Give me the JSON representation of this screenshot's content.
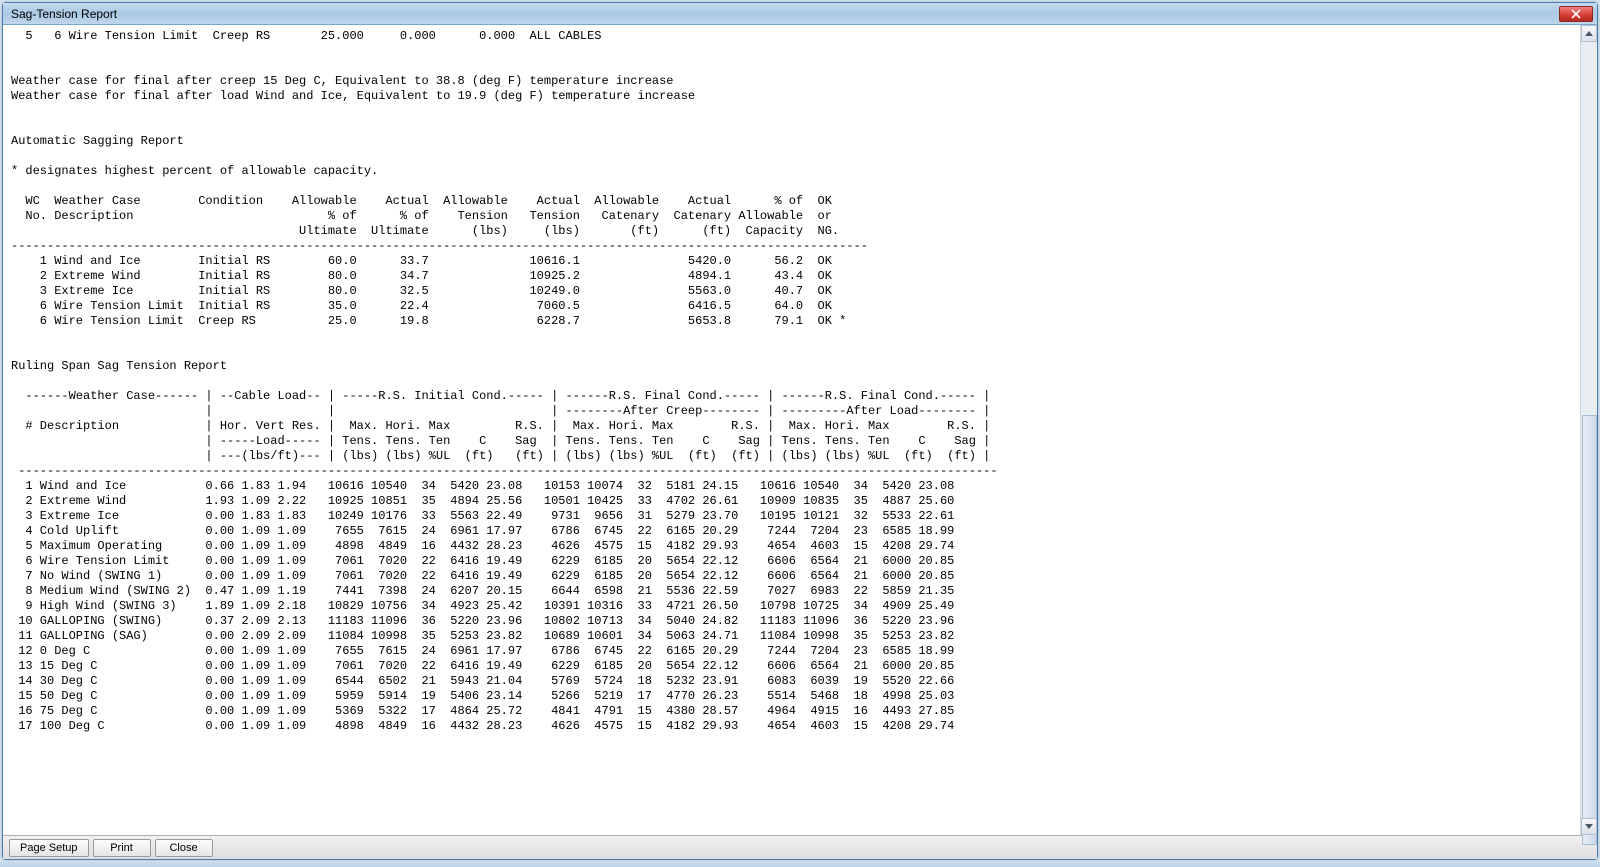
{
  "window": {
    "title": "Sag-Tension Report"
  },
  "toolbar": {
    "page_setup": "Page Setup",
    "print": "Print",
    "close": "Close"
  },
  "report": {
    "top_line": "  5   6 Wire Tension Limit  Creep RS       25.000     0.000      0.000  ALL CABLES",
    "wc_note_creep": "Weather case for final after creep 15 Deg C, Equivalent to 38.8 (deg F) temperature increase",
    "wc_note_load": "Weather case for final after load Wind and Ice, Equivalent to 19.9 (deg F) temperature increase",
    "auto_sagging_title": "Automatic Sagging Report",
    "star_note": "* designates highest percent of allowable capacity.",
    "sag_header": [
      "  WC  Weather Case        Condition    Allowable    Actual  Allowable    Actual  Allowable    Actual      % of  OK",
      "  No. Description                           % of      % of    Tension   Tension   Catenary  Catenary Allowable  or",
      "                                        Ultimate  Ultimate      (lbs)     (lbs)       (ft)      (ft)  Capacity  NG.",
      "-----------------------------------------------------------------------------------------------------------------------"
    ],
    "sag_rows": [
      "    1 Wind and Ice        Initial RS        60.0      33.7              10616.1               5420.0      56.2  OK",
      "    2 Extreme Wind        Initial RS        80.0      34.7              10925.2               4894.1      43.4  OK",
      "    3 Extreme Ice         Initial RS        80.0      32.5              10249.0               5563.0      40.7  OK",
      "    6 Wire Tension Limit  Initial RS        35.0      22.4               7060.5               6416.5      64.0  OK",
      "    6 Wire Tension Limit  Creep RS          25.0      19.8               6228.7               5653.8      79.1  OK *"
    ],
    "ruling_title": "Ruling Span Sag Tension Report",
    "ruling_header": [
      "  ------Weather Case------ | --Cable Load-- | -----R.S. Initial Cond.----- | ------R.S. Final Cond.----- | ------R.S. Final Cond.----- |",
      "                           |                |                              | --------After Creep-------- | ---------After Load-------- |",
      "  # Description            | Hor. Vert Res. |  Max. Hori. Max         R.S. |  Max. Hori. Max        R.S. |  Max. Hori. Max        R.S. |",
      "                           | -----Load----- | Tens. Tens. Ten    C    Sag  | Tens. Tens. Ten    C    Sag | Tens. Tens. Ten    C    Sag |",
      "                           | ---(lbs/ft)--- | (lbs) (lbs) %UL  (ft)   (ft) | (lbs) (lbs) %UL  (ft)  (ft) | (lbs) (lbs) %UL  (ft)  (ft) |",
      " ----------------------------------------------------------------------------------------------------------------------------------------"
    ],
    "ruling_rows": [
      "  1 Wind and Ice           0.66 1.83 1.94   10616 10540  34  5420 23.08   10153 10074  32  5181 24.15   10616 10540  34  5420 23.08",
      "  2 Extreme Wind           1.93 1.09 2.22   10925 10851  35  4894 25.56   10501 10425  33  4702 26.61   10909 10835  35  4887 25.60",
      "  3 Extreme Ice            0.00 1.83 1.83   10249 10176  33  5563 22.49    9731  9656  31  5279 23.70   10195 10121  32  5533 22.61",
      "  4 Cold Uplift            0.00 1.09 1.09    7655  7615  24  6961 17.97    6786  6745  22  6165 20.29    7244  7204  23  6585 18.99",
      "  5 Maximum Operating      0.00 1.09 1.09    4898  4849  16  4432 28.23    4626  4575  15  4182 29.93    4654  4603  15  4208 29.74",
      "  6 Wire Tension Limit     0.00 1.09 1.09    7061  7020  22  6416 19.49    6229  6185  20  5654 22.12    6606  6564  21  6000 20.85",
      "  7 No Wind (SWING 1)      0.00 1.09 1.09    7061  7020  22  6416 19.49    6229  6185  20  5654 22.12    6606  6564  21  6000 20.85",
      "  8 Medium Wind (SWING 2)  0.47 1.09 1.19    7441  7398  24  6207 20.15    6644  6598  21  5536 22.59    7027  6983  22  5859 21.35",
      "  9 High Wind (SWING 3)    1.89 1.09 2.18   10829 10756  34  4923 25.42   10391 10316  33  4721 26.50   10798 10725  34  4909 25.49",
      " 10 GALLOPING (SWING)      0.37 2.09 2.13   11183 11096  36  5220 23.96   10802 10713  34  5040 24.82   11183 11096  36  5220 23.96",
      " 11 GALLOPING (SAG)        0.00 2.09 2.09   11084 10998  35  5253 23.82   10689 10601  34  5063 24.71   11084 10998  35  5253 23.82",
      " 12 0 Deg C                0.00 1.09 1.09    7655  7615  24  6961 17.97    6786  6745  22  6165 20.29    7244  7204  23  6585 18.99",
      " 13 15 Deg C               0.00 1.09 1.09    7061  7020  22  6416 19.49    6229  6185  20  5654 22.12    6606  6564  21  6000 20.85",
      " 14 30 Deg C               0.00 1.09 1.09    6544  6502  21  5943 21.04    5769  5724  18  5232 23.91    6083  6039  19  5520 22.66",
      " 15 50 Deg C               0.00 1.09 1.09    5959  5914  19  5406 23.14    5266  5219  17  4770 26.23    5514  5468  18  4998 25.03",
      " 16 75 Deg C               0.00 1.09 1.09    5369  5322  17  4864 25.72    4841  4791  15  4380 28.57    4964  4915  16  4493 27.85",
      " 17 100 Deg C              0.00 1.09 1.09    4898  4849  16  4432 28.23    4626  4575  15  4182 29.93    4654  4603  15  4208 29.74"
    ]
  }
}
